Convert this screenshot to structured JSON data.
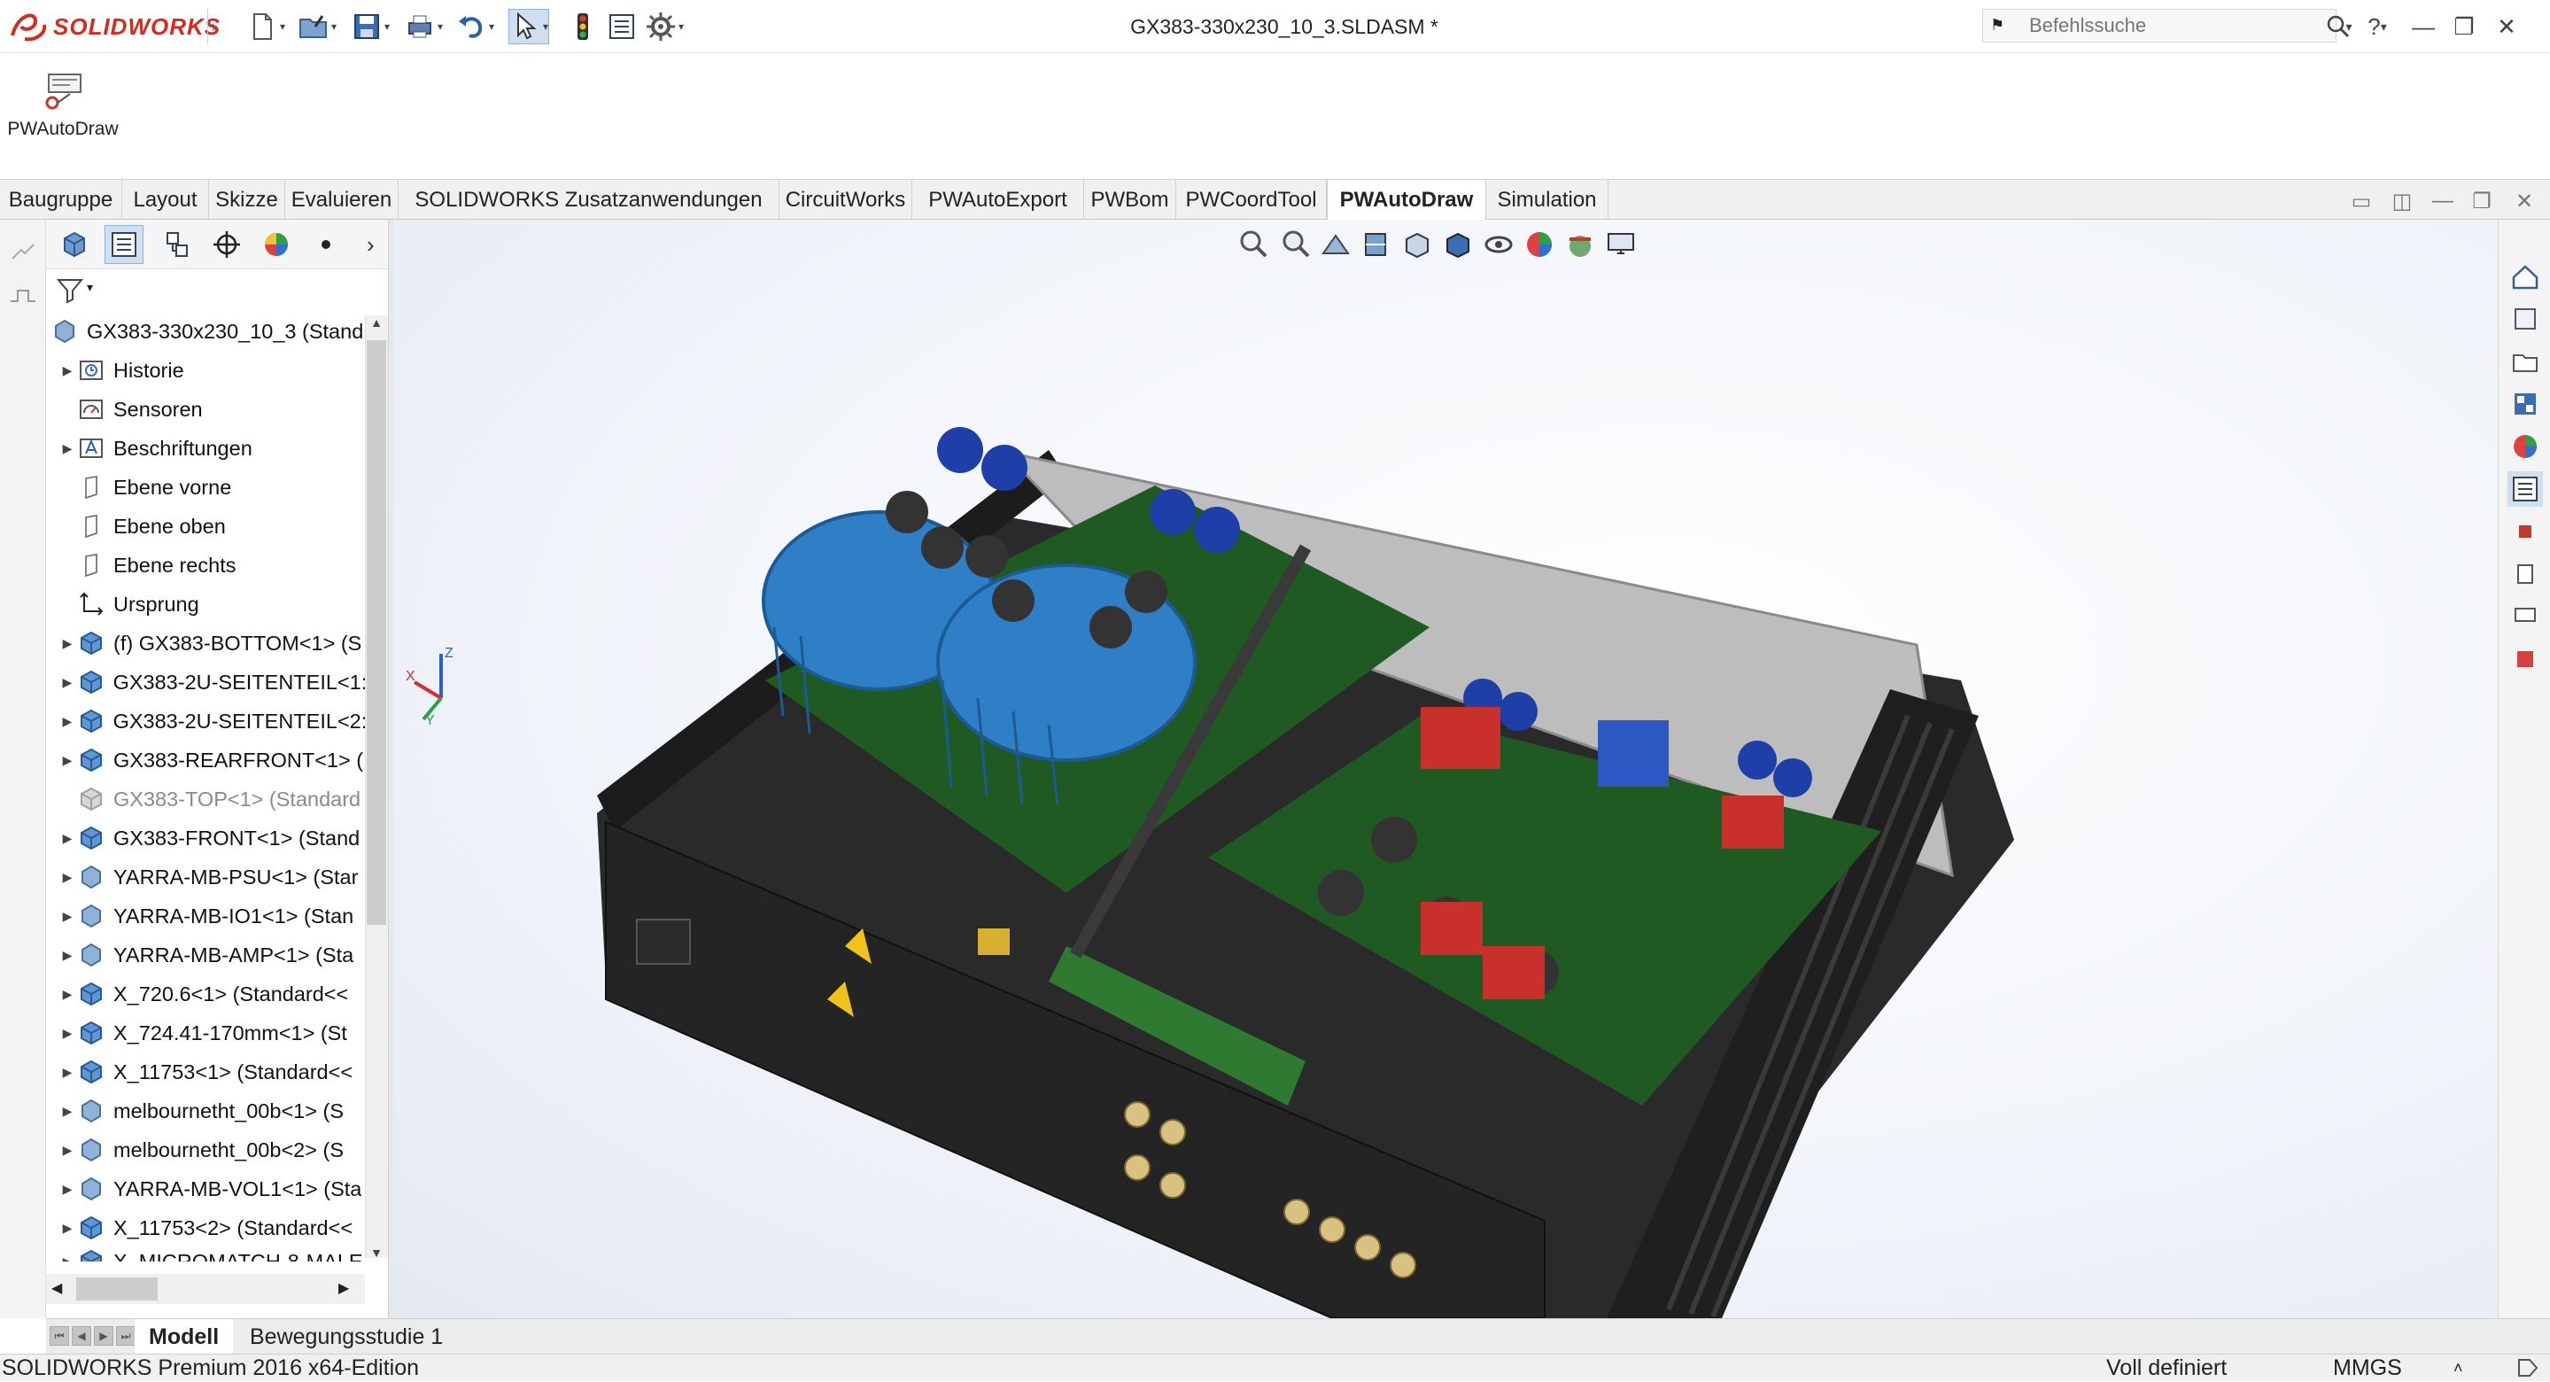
{
  "app": {
    "brand": "SOLIDWORKS",
    "document_title": "GX383-330x230_10_3.SLDASM *"
  },
  "search": {
    "placeholder": "Befehlssuche"
  },
  "command_manager": {
    "pwautodraw_label": "PWAutoDraw"
  },
  "tabs": [
    {
      "label": "Baugruppe"
    },
    {
      "label": "Layout"
    },
    {
      "label": "Skizze"
    },
    {
      "label": "Evaluieren"
    },
    {
      "label": "SOLIDWORKS Zusatzanwendungen"
    },
    {
      "label": "CircuitWorks"
    },
    {
      "label": "PWAutoExport"
    },
    {
      "label": "PWBom"
    },
    {
      "label": "PWCoordTool"
    },
    {
      "label": "PWAutoDraw"
    },
    {
      "label": "Simulation"
    }
  ],
  "tree": {
    "root": "GX383-330x230_10_3  (Stand",
    "items": [
      {
        "label": "Historie"
      },
      {
        "label": "Sensoren"
      },
      {
        "label": "Beschriftungen"
      },
      {
        "label": "Ebene vorne"
      },
      {
        "label": "Ebene oben"
      },
      {
        "label": "Ebene rechts"
      },
      {
        "label": "Ursprung"
      },
      {
        "label": "(f) GX383-BOTTOM<1> (S"
      },
      {
        "label": "GX383-2U-SEITENTEIL<1:"
      },
      {
        "label": "GX383-2U-SEITENTEIL<2:"
      },
      {
        "label": "GX383-REARFRONT<1> ("
      },
      {
        "label": "GX383-TOP<1> (Standard"
      },
      {
        "label": "GX383-FRONT<1> (Stand"
      },
      {
        "label": "YARRA-MB-PSU<1> (Star"
      },
      {
        "label": "YARRA-MB-IO1<1> (Stan"
      },
      {
        "label": "YARRA-MB-AMP<1> (Sta"
      },
      {
        "label": "X_720.6<1> (Standard<<"
      },
      {
        "label": "X_724.41-170mm<1> (St"
      },
      {
        "label": "X_11753<1> (Standard<<"
      },
      {
        "label": "melbournetht_00b<1> (S"
      },
      {
        "label": "melbournetht_00b<2> (S"
      },
      {
        "label": "YARRA-MB-VOL1<1> (Sta"
      },
      {
        "label": "X_11753<2> (Standard<<"
      },
      {
        "label": "X_MICROMATCH-8-MALE"
      }
    ]
  },
  "triad": {
    "x": "X",
    "y": "Y",
    "z": "Z"
  },
  "bottom_tabs": [
    {
      "label": "Modell"
    },
    {
      "label": "Bewegungsstudie 1"
    }
  ],
  "status": {
    "edition": "SOLIDWORKS Premium 2016 x64-Edition",
    "definition": "Voll definiert",
    "units": "MMGS"
  },
  "colors": {
    "brand_red": "#d52b1e",
    "pcb_green": "#1f5a22",
    "heatsink_blue": "#2f7fc6",
    "chassis": "#2a2a2a"
  }
}
